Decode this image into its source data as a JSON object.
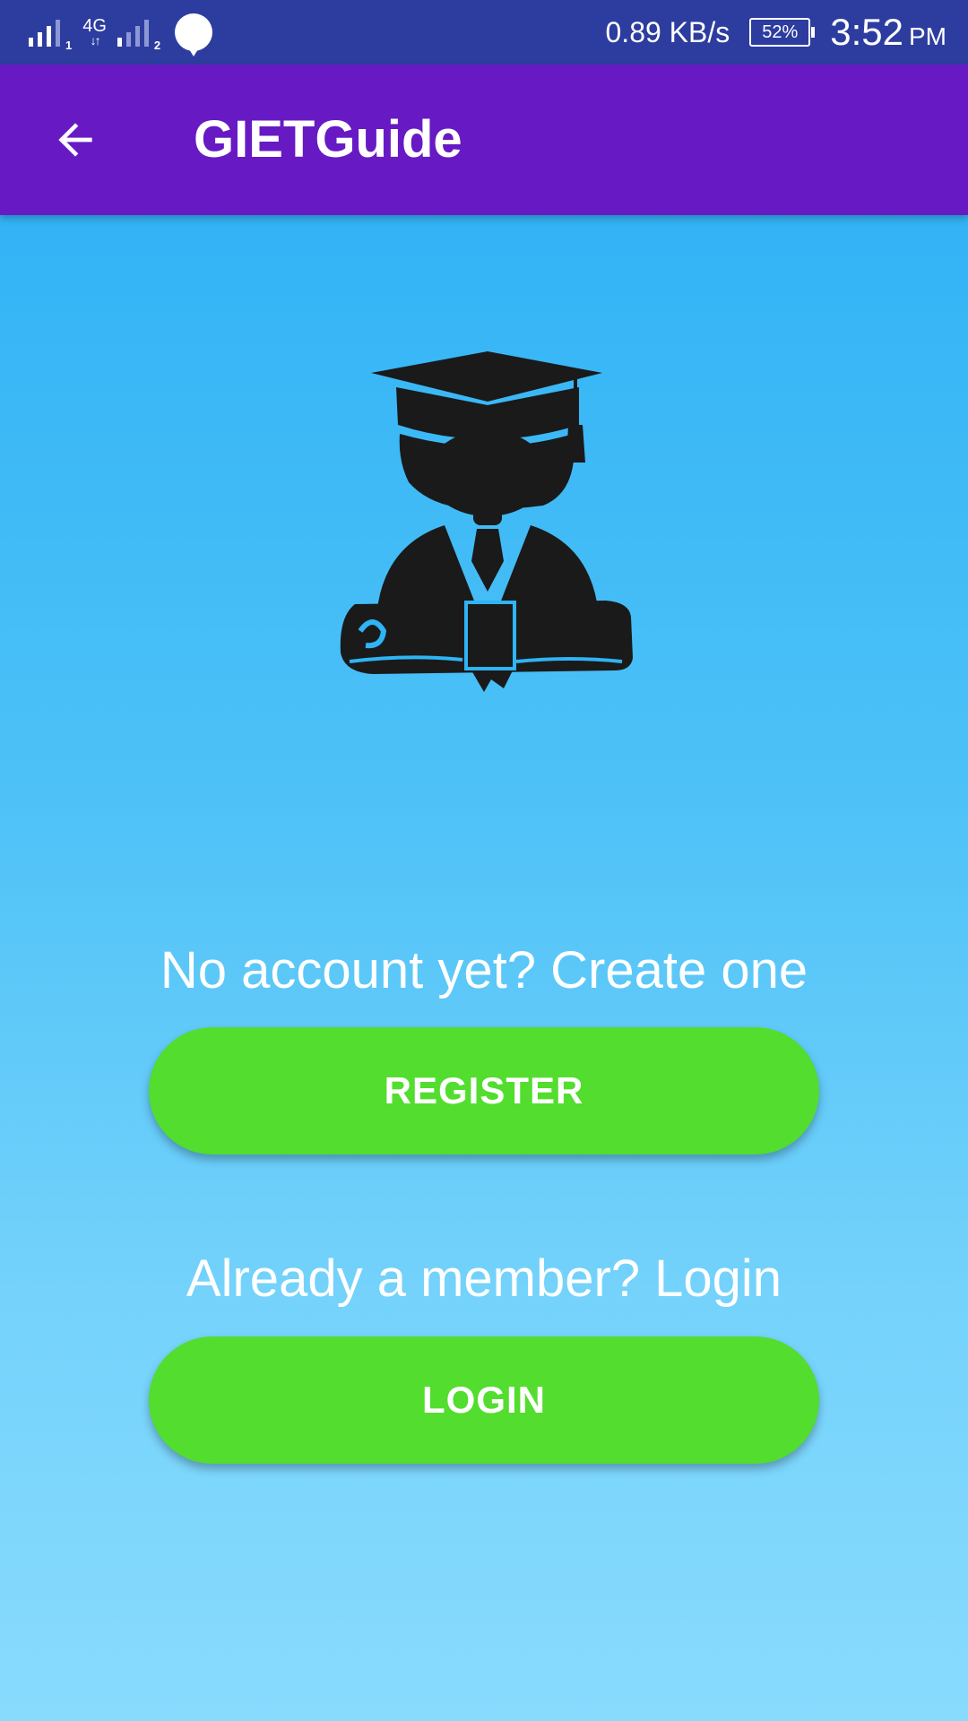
{
  "status_bar": {
    "sim1_label": "1",
    "network_type": "4G",
    "sim2_label": "2",
    "speed": "0.89 KB/s",
    "battery": "52%",
    "time": "3:52",
    "ampm": "PM"
  },
  "app_bar": {
    "back_icon": "arrow-left-icon",
    "title": "GIETGuide"
  },
  "illustration": {
    "icon": "graduate-icon"
  },
  "register": {
    "prompt": "No account yet? Create one",
    "button_label": "REGISTER"
  },
  "login": {
    "prompt": "Already a member? Login",
    "button_label": "LOGIN"
  },
  "colors": {
    "status_bar": "#2d3d9f",
    "app_bar": "#671ac4",
    "background_top": "#29aef5",
    "background_bottom": "#88dbfd",
    "button": "#53dd2e",
    "text": "#ffffff"
  }
}
